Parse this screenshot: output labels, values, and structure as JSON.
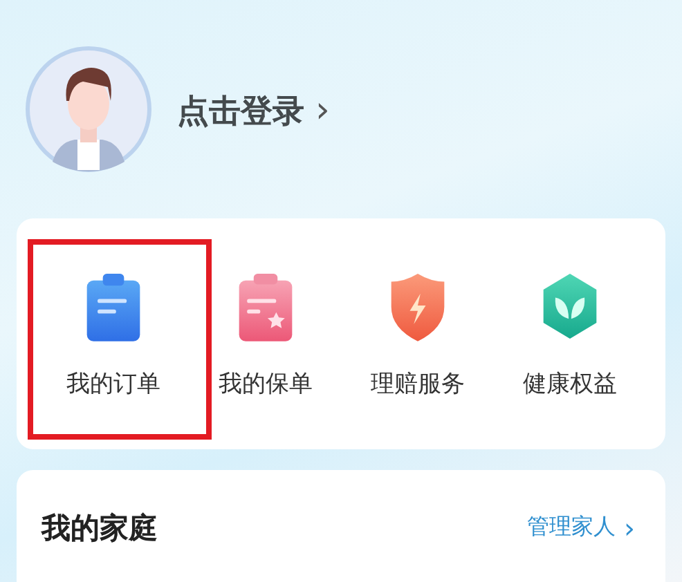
{
  "profile": {
    "login_text": "点击登录",
    "chevron": "›"
  },
  "services": [
    {
      "kind": "order",
      "label": "我的订单",
      "highlighted": true
    },
    {
      "kind": "policy",
      "label": "我的保单",
      "highlighted": false
    },
    {
      "kind": "claim",
      "label": "理赔服务",
      "highlighted": false
    },
    {
      "kind": "health",
      "label": "健康权益",
      "highlighted": false
    }
  ],
  "family": {
    "title": "我的家庭",
    "link": "管理家人",
    "chevron": "›"
  }
}
